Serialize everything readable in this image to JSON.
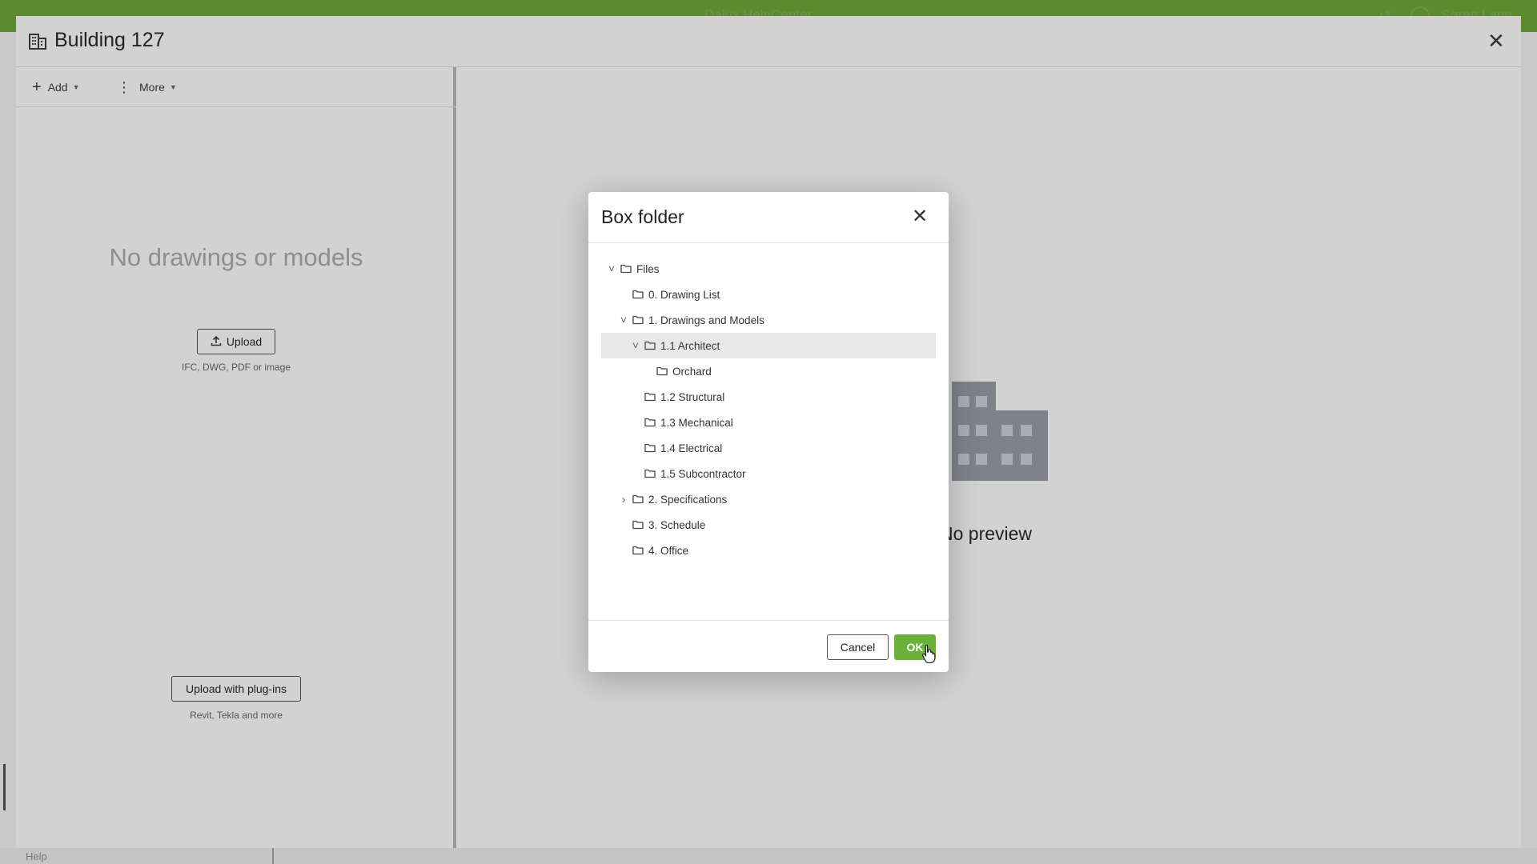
{
  "app": {
    "top_title": "Dalux HelpCenter",
    "user_name": "Søren Lang",
    "help_label": "Help"
  },
  "panel": {
    "title": "Building 127",
    "toolbar": {
      "add_label": "Add",
      "more_label": "More"
    },
    "empty_title": "No drawings or models",
    "upload_label": "Upload",
    "upload_hint": "IFC, DWG, PDF or image",
    "plugins_label": "Upload with plug-ins",
    "plugins_hint": "Revit, Tekla and more",
    "no_preview": "No preview"
  },
  "dialog": {
    "title": "Box folder",
    "tree": [
      {
        "label": "Files",
        "level": 0,
        "expander": "open"
      },
      {
        "label": "0. Drawing List",
        "level": 1,
        "expander": "none"
      },
      {
        "label": "1. Drawings and Models",
        "level": 1,
        "expander": "open"
      },
      {
        "label": "1.1 Architect",
        "level": 2,
        "expander": "open",
        "selected": true
      },
      {
        "label": "Orchard",
        "level": 3,
        "expander": "none"
      },
      {
        "label": "1.2 Structural",
        "level": 2,
        "expander": "none"
      },
      {
        "label": "1.3 Mechanical",
        "level": 2,
        "expander": "none"
      },
      {
        "label": "1.4 Electrical",
        "level": 2,
        "expander": "none"
      },
      {
        "label": "1.5 Subcontractor",
        "level": 2,
        "expander": "none"
      },
      {
        "label": "2. Specifications",
        "level": 1,
        "expander": "closed"
      },
      {
        "label": "3. Schedule",
        "level": 1,
        "expander": "none"
      },
      {
        "label": "4. Office",
        "level": 1,
        "expander": "none"
      }
    ],
    "cancel_label": "Cancel",
    "ok_label": "OK"
  },
  "colors": {
    "brand_green": "#5c8a2d",
    "ok_green": "#6ab03a",
    "selected_row": "#e8e8e8"
  }
}
